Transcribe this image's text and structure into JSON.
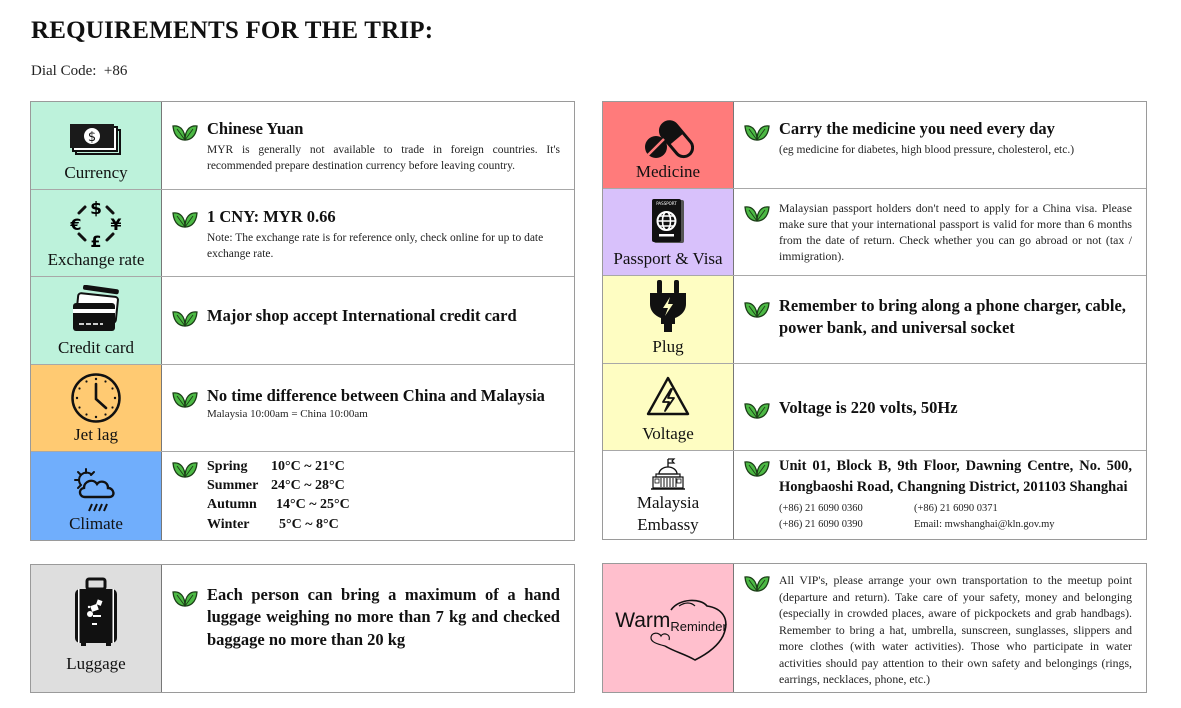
{
  "page": {
    "title": "REQUIREMENTS FOR THE TRIP:",
    "dial_code_label": "Dial Code:",
    "dial_code_value": "+86"
  },
  "colors": {
    "mint": "#bdf2db",
    "orange": "#ffca72",
    "blue": "#70aefc",
    "red": "#ff7b7b",
    "lavender": "#d8c1fb",
    "yellow": "#fefdc2",
    "white": "#ffffff",
    "grey": "#dedede",
    "pink": "#ffbfcd",
    "leaf_green": "#3fae3a"
  },
  "left": {
    "currency": {
      "label": "Currency",
      "icon": "money-icon",
      "heading": "Chinese Yuan",
      "text": "MYR is generally not available to trade in foreign countries. It's recommended prepare destination currency before leaving country."
    },
    "exchange": {
      "label": "Exchange rate",
      "icon": "currency-exchange-icon",
      "heading": "1 CNY: MYR 0.66",
      "text": "Note: The exchange rate is for reference only, check online for up to date exchange rate."
    },
    "credit": {
      "label": "Credit card",
      "icon": "credit-card-icon",
      "heading": "Major shop accept International credit card"
    },
    "jetlag": {
      "label": "Jet lag",
      "icon": "clock-icon",
      "heading": "No time difference between China and Malaysia",
      "text": "Malaysia 10:00am = China 10:00am"
    },
    "climate": {
      "label": "Climate",
      "icon": "weather-icon",
      "seasons": [
        {
          "season": "Spring",
          "range": "10°C ~ 21°C"
        },
        {
          "season": "Summer",
          "range": "24°C ~ 28°C"
        },
        {
          "season": "Autumn",
          "range": "14°C ~ 25°C"
        },
        {
          "season": "Winter",
          "range": "5°C ~ 8°C"
        }
      ]
    }
  },
  "right": {
    "medicine": {
      "label": "Medicine",
      "icon": "pills-icon",
      "heading": "Carry the medicine you need every day",
      "text": "(eg medicine for diabetes, high blood pressure, cholesterol, etc.)"
    },
    "passport": {
      "label": "Passport & Visa",
      "icon": "passport-icon",
      "icon_text": "PASSPORT",
      "text": "Malaysian passport holders don't need to apply for a China visa. Please make sure that your international passport is valid for more than 6 months from the date of return. Check whether you can go abroad or not (tax / immigration)."
    },
    "plug": {
      "label": "Plug",
      "icon": "plug-icon",
      "heading": "Remember to bring along a phone charger, cable, power bank, and universal socket"
    },
    "voltage": {
      "label": "Voltage",
      "icon": "high-voltage-icon",
      "heading": "Voltage is 220 volts, 50Hz"
    },
    "embassy": {
      "label_line1": "Malaysia",
      "label_line2": "Embassy",
      "icon": "embassy-building-icon",
      "address": "Unit 01, Block B, 9th Floor, Dawning Centre, No. 500, Hongbaoshi Road, Changning District, 201103 Shanghai",
      "phone1": "(+86) 21 6090 0360",
      "phone2": "(+86) 21 6090 0371",
      "phone3": "(+86) 21 6090 0390",
      "email": "Email: mwshanghai@kln.gov.my"
    }
  },
  "luggage": {
    "label": "Luggage",
    "icon": "suitcase-icon",
    "heading": "Each person can bring a maximum of a hand luggage weighing no more than 7 kg and checked baggage no more than 20 kg"
  },
  "reminder": {
    "label_warm": "Warm",
    "label_reminder": "Reminder",
    "icon": "heart-icon",
    "text": "All VIP's, please arrange your own transportation to the meetup point (departure and return). Take care of your safety, money and belonging (especially in crowded places, aware of pickpockets and grab handbags). Remember to bring a hat, umbrella, sunscreen, sunglasses, slippers and more clothes (with water activities). Those who participate in water activities should pay attention to their own safety and belongings (rings, earrings, necklaces, phone, etc.)"
  }
}
